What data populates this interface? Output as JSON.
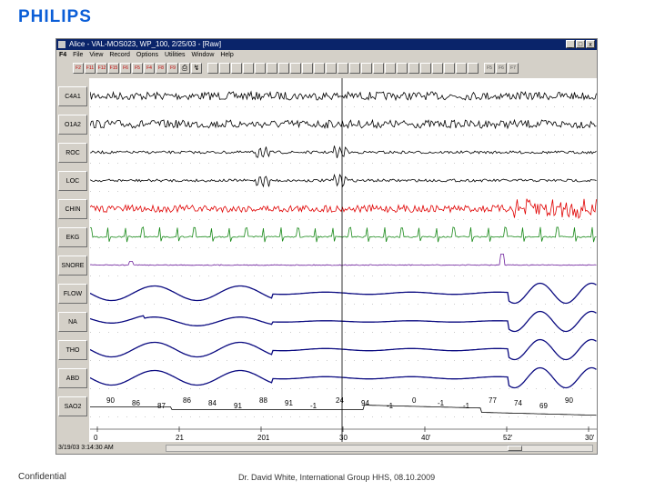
{
  "brand": {
    "logo": "PHILIPS"
  },
  "window": {
    "title": "Alice - VAL-MOS023, WP_100, 2/25/03 - [Raw]",
    "controls": [
      "_",
      "□",
      "x"
    ]
  },
  "menu": {
    "hotkey": "F4",
    "items": [
      "File",
      "View",
      "Record",
      "Options",
      "Utilities",
      "Window",
      "Help"
    ]
  },
  "toolbar": {
    "red_buttons": [
      "F2",
      "F11",
      "F12",
      "F15",
      "F6",
      "F5",
      "F4",
      "F8",
      "F9"
    ],
    "print_icon": "printer-icon",
    "montage_buttons_count_label": "",
    "right_buttons": [
      "F5",
      "F6",
      "F7"
    ]
  },
  "channels": [
    {
      "label": "C4A1",
      "color": "#000000"
    },
    {
      "label": "O1A2",
      "color": "#000000"
    },
    {
      "label": "ROC",
      "color": "#000000"
    },
    {
      "label": "LOC",
      "color": "#000000"
    },
    {
      "label": "CHIN",
      "color": "#e00000"
    },
    {
      "label": "EKG",
      "color": "#1a8a1a"
    },
    {
      "label": "SNORE",
      "color": "#6a1b9a"
    },
    {
      "label": "FLOW",
      "color": "#0a0a80"
    },
    {
      "label": "NA",
      "color": "#0a0a80"
    },
    {
      "label": "THO",
      "color": "#0a0a80"
    },
    {
      "label": "ABD",
      "color": "#0a0a80"
    },
    {
      "label": "SAO2",
      "color": "#000000"
    }
  ],
  "spo2_values": [
    "90",
    "86",
    "87",
    "86",
    "84",
    "91",
    "88",
    "91",
    "-1",
    "24",
    "94",
    "-1",
    "0",
    "-1",
    "-1",
    "77",
    "74",
    "69",
    "90"
  ],
  "time_axis": [
    "0",
    "21",
    "201",
    "30",
    "40'",
    "52'",
    "30'"
  ],
  "status": {
    "timestamp": "3/19/03 3:14:30 AM"
  },
  "footer": {
    "left": "Confidential",
    "center": "Dr. David White, International Group HHS, 08.10.2009"
  }
}
